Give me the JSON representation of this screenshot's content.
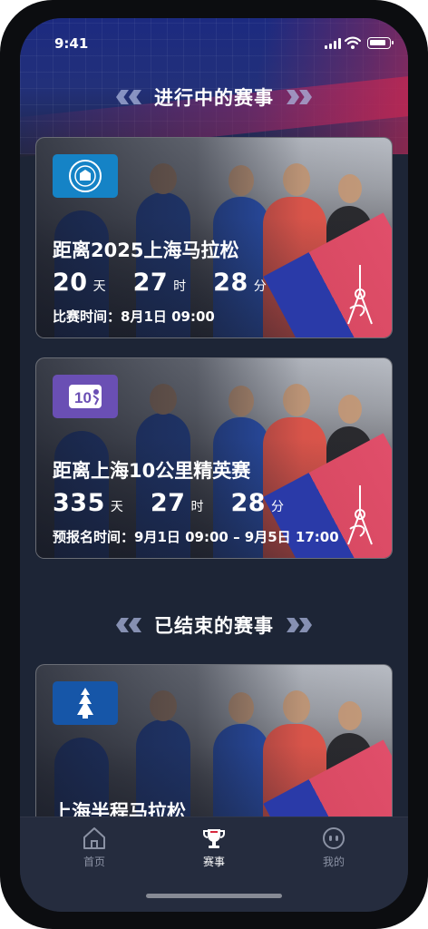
{
  "status_bar": {
    "time": "9:41"
  },
  "sections": {
    "ongoing_title": "进行中的赛事",
    "ended_title": "已结束的赛事"
  },
  "ongoing": [
    {
      "badge_icon": "university-seal-icon",
      "badge_color": "#1583c6",
      "title": "距离2025上海马拉松",
      "days": "20",
      "days_unit": "天",
      "hours": "27",
      "hours_unit": "时",
      "minutes": "28",
      "minutes_unit": "分",
      "time_label": "比赛时间：",
      "time_value": "8月1日  09:00"
    },
    {
      "badge_icon": "10k-runner-icon",
      "badge_color": "#6a4fb4",
      "badge_text": "10",
      "title": "距离上海10公里精英赛",
      "days": "335",
      "days_unit": "天",
      "hours": "27",
      "hours_unit": "时",
      "minutes": "28",
      "minutes_unit": "分",
      "time_label": "预报名时间：",
      "time_value": "9月1日  09:00 – 9月5日 17:00"
    }
  ],
  "ended": [
    {
      "badge_icon": "half-marathon-icon",
      "badge_color": "#1656a8",
      "title": "上海半程马拉松"
    }
  ],
  "tabbar": {
    "home": "首页",
    "events": "赛事",
    "mine": "我的",
    "active_color": "#ffffff",
    "inactive_color": "#8b92a4"
  }
}
